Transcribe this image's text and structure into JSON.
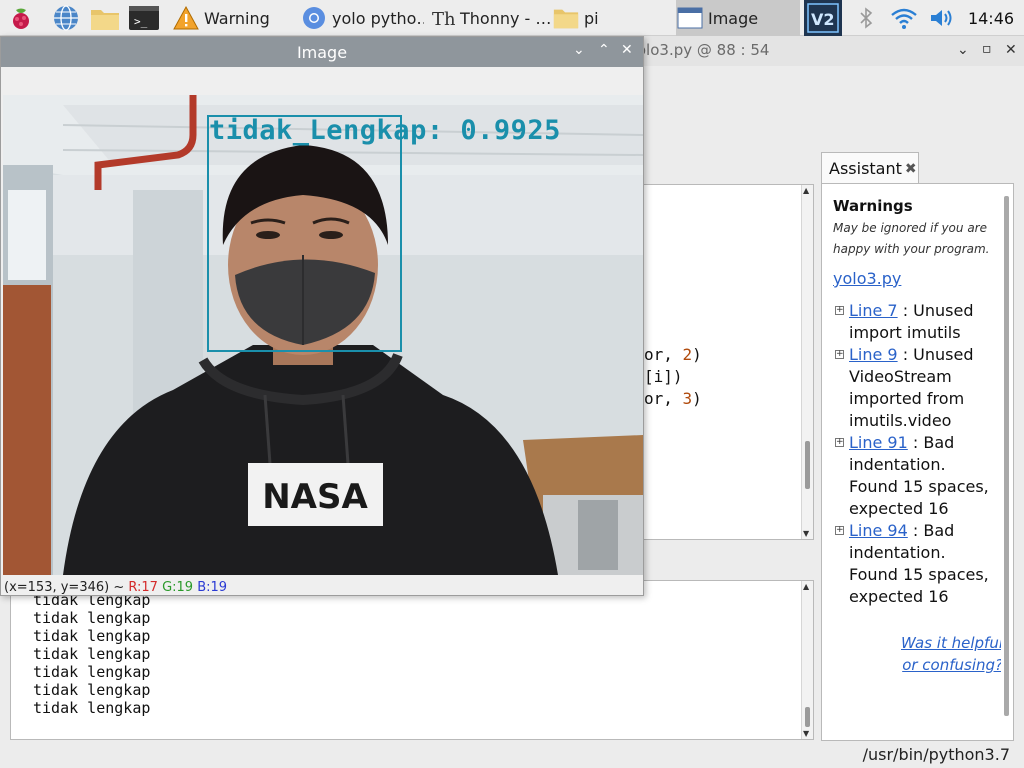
{
  "taskbar": {
    "tasks": [
      {
        "label": "Warning",
        "icon": "warning-icon"
      },
      {
        "label": "yolo pytho…",
        "icon": "chromium-icon"
      },
      {
        "label": "Thonny  -  …",
        "icon": "thonny-icon"
      },
      {
        "label": "pi",
        "icon": "folder-icon"
      },
      {
        "label": "Image",
        "icon": "window-icon"
      }
    ],
    "clock": "14:46"
  },
  "thonny": {
    "title": "yolo3.py  @  88 : 54",
    "editor_lines": [
      {
        "prefix": "or, ",
        "num": "2",
        "suffix": ")"
      },
      {
        "prefix": "[i])",
        "num": "",
        "suffix": ""
      },
      {
        "prefix": "or, ",
        "num": "3",
        "suffix": ")"
      }
    ],
    "shell_lines": [
      "tidak lengkap",
      "tidak lengkap",
      "tidak lengkap",
      "tidak lengkap",
      "tidak lengkap",
      "tidak lengkap",
      "tidak lengkap"
    ],
    "status_path": "/usr/bin/python3.7"
  },
  "assistant": {
    "tab_label": "Assistant",
    "heading": "Warnings",
    "subtitle": "May be ignored if you are happy with your program.",
    "file_link": "yolo3.py",
    "warnings": [
      {
        "link": "Line 7",
        "text": " : Unused import imutils"
      },
      {
        "link": "Line 9",
        "text": " : Unused VideoStream imported from imutils.video"
      },
      {
        "link": "Line 91",
        "text": " : Bad indentation. Found 15 spaces, expected 16"
      },
      {
        "link": "Line 94",
        "text": " : Bad indentation. Found 15 spaces, expected 16"
      }
    ],
    "help_link": "Was it helpful or confusing?"
  },
  "image_window": {
    "title": "Image",
    "detection_label": "tidak_Lengkap: 0.9925",
    "status": {
      "coords": "(x=153, y=346) ~ ",
      "r": "R:17",
      "g": "G:19",
      "b": "B:19"
    },
    "shirt_text": "NASA"
  },
  "colors": {
    "detection": "#1a8fab",
    "link": "#2a62c9",
    "titlebar": "#8f969c"
  }
}
